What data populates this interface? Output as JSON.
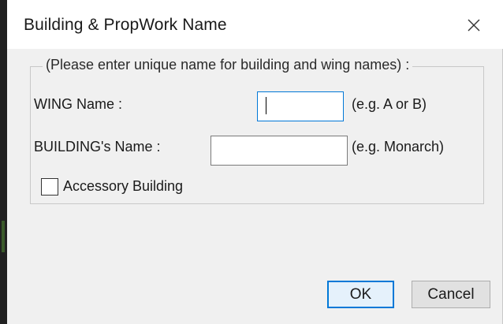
{
  "window": {
    "title": "Building & PropWork Name",
    "close_icon": "close-icon"
  },
  "group": {
    "legend": "(Please enter unique name for building and wing names) :"
  },
  "wing": {
    "label": "WING Name :",
    "value": "",
    "hint": "(e.g. A or B)"
  },
  "building": {
    "label": "BUILDING's Name :",
    "value": "",
    "hint": "(e.g. Monarch)"
  },
  "accessory": {
    "label": "Accessory Building",
    "checked": false
  },
  "buttons": {
    "ok": "OK",
    "cancel": "Cancel"
  },
  "colors": {
    "dialog_bg": "#f0f0f0",
    "focus_accent": "#0078d7",
    "button_bg": "#e1e1e1"
  }
}
